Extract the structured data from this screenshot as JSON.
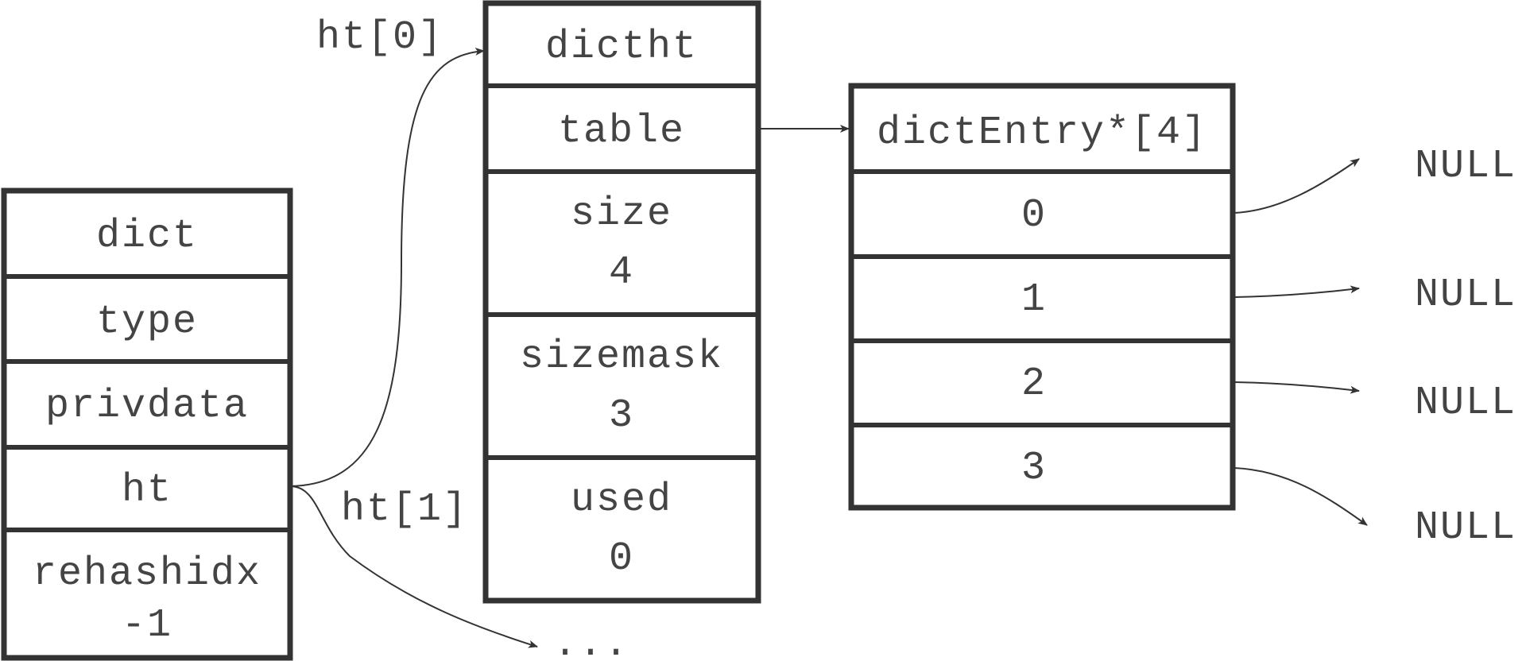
{
  "dict": {
    "title": "dict",
    "fields": [
      {
        "name": "type"
      },
      {
        "name": "privdata"
      },
      {
        "name": "ht"
      },
      {
        "name": "rehashidx",
        "value": "-1"
      }
    ]
  },
  "dictht": {
    "title": "dictht",
    "fields": [
      {
        "name": "table"
      },
      {
        "name": "size",
        "value": "4"
      },
      {
        "name": "sizemask",
        "value": "3"
      },
      {
        "name": "used",
        "value": "0"
      }
    ]
  },
  "table": {
    "title": "dictEntry*[4]",
    "slots": [
      "0",
      "1",
      "2",
      "3"
    ],
    "targets": [
      "NULL",
      "NULL",
      "NULL",
      "NULL"
    ]
  },
  "pointer_labels": {
    "ht0": "ht[0]",
    "ht1": "ht[1]",
    "ellipsis": "..."
  },
  "colors": {
    "stroke": "#333333",
    "text": "#444444"
  }
}
